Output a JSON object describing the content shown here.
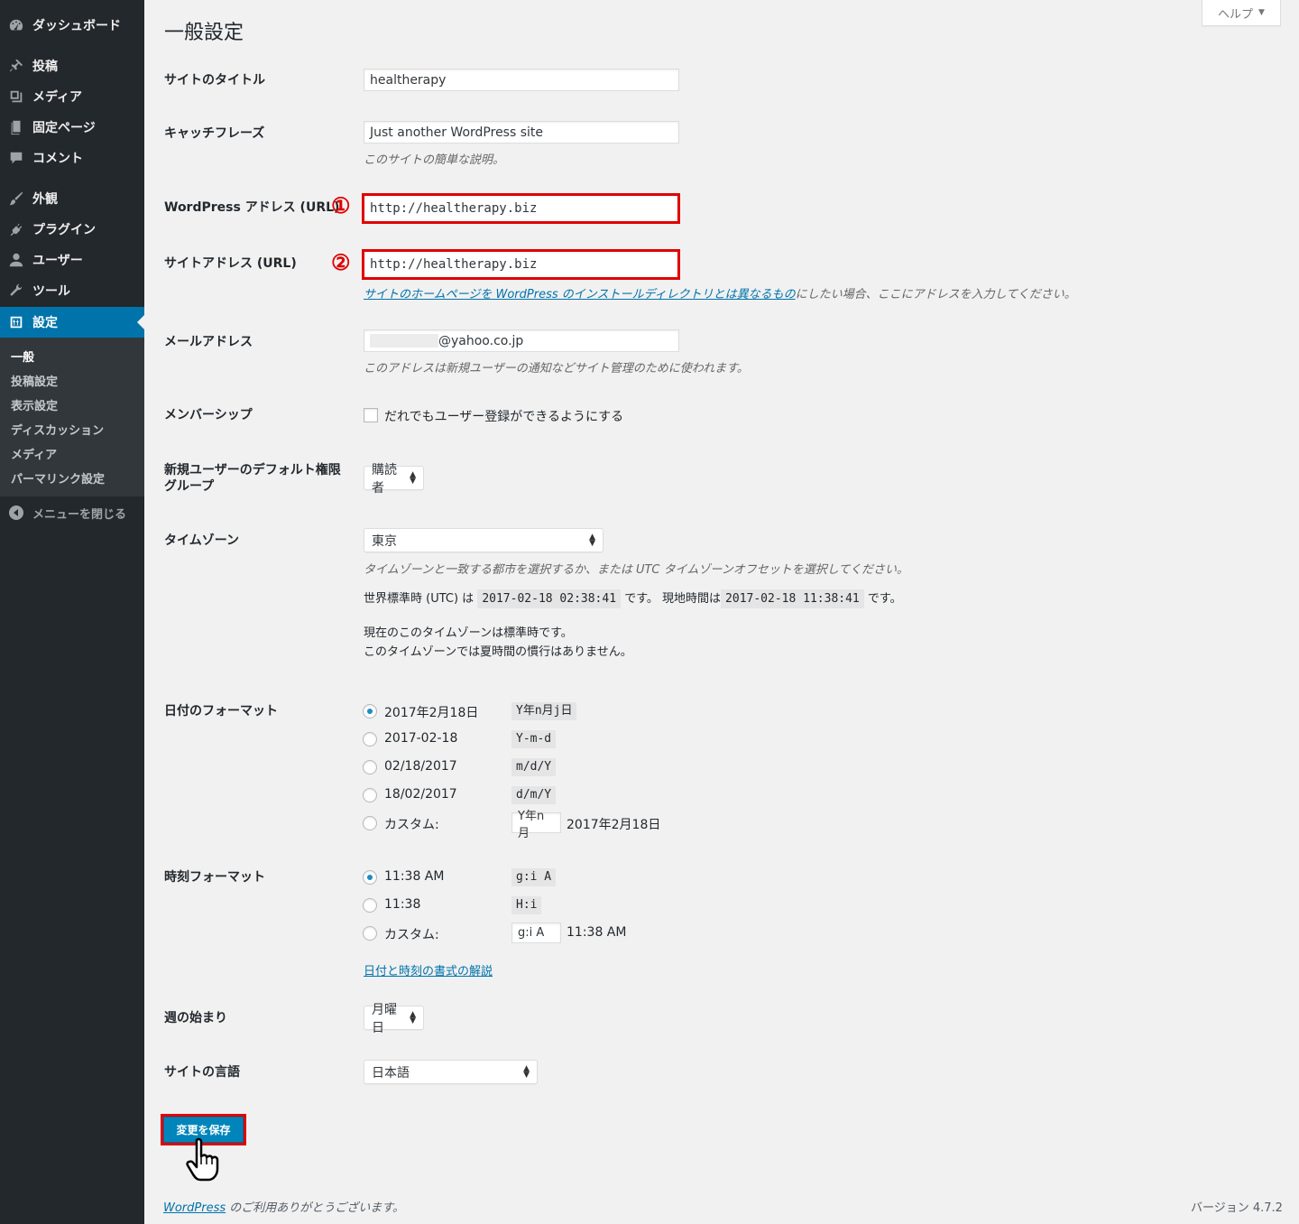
{
  "help": {
    "label": "ヘルプ",
    "arrow": "▼"
  },
  "sidebar": {
    "items": [
      {
        "label": "ダッシュボード",
        "icon": "dashboard-icon"
      },
      {
        "label": "投稿",
        "icon": "pin-icon"
      },
      {
        "label": "メディア",
        "icon": "media-icon"
      },
      {
        "label": "固定ページ",
        "icon": "page-icon"
      },
      {
        "label": "コメント",
        "icon": "comment-icon"
      },
      {
        "label": "外観",
        "icon": "brush-icon"
      },
      {
        "label": "プラグイン",
        "icon": "plugin-icon"
      },
      {
        "label": "ユーザー",
        "icon": "user-icon"
      },
      {
        "label": "ツール",
        "icon": "wrench-icon"
      },
      {
        "label": "設定",
        "icon": "settings-icon"
      }
    ],
    "submenu": [
      "一般",
      "投稿設定",
      "表示設定",
      "ディスカッション",
      "メディア",
      "パーマリンク設定"
    ],
    "collapse": "メニューを閉じる"
  },
  "page": {
    "title": "一般設定"
  },
  "fields": {
    "site_title": {
      "label": "サイトのタイトル",
      "value": "healtherapy"
    },
    "tagline": {
      "label": "キャッチフレーズ",
      "value": "Just another WordPress site",
      "desc": "このサイトの簡単な説明。"
    },
    "wp_url": {
      "label": "WordPress アドレス (URL)",
      "value": "http://healtherapy.biz",
      "marker": "①"
    },
    "site_url": {
      "label": "サイトアドレス (URL)",
      "value": "http://healtherapy.biz",
      "marker": "②",
      "desc_link": "サイトのホームページを WordPress のインストールディレクトリとは異なるもの",
      "desc_rest": "にしたい場合、ここにアドレスを入力してください。"
    },
    "email": {
      "label": "メールアドレス",
      "value": "@yahoo.co.jp",
      "desc": "このアドレスは新規ユーザーの通知などサイト管理のために使われます。"
    },
    "membership": {
      "label": "メンバーシップ",
      "checkbox": "だれでもユーザー登録ができるようにする"
    },
    "default_role": {
      "label_1": "新規ユーザーのデフォルト権限",
      "label_2": "グループ",
      "value": "購読者"
    },
    "timezone": {
      "label": "タイムゾーン",
      "value": "東京",
      "desc": "タイムゾーンと一致する都市を選択するか、または UTC タイムゾーンオフセットを選択してください。",
      "utc_prefix": "世界標準時 (UTC) は",
      "utc_time": "2017-02-18 02:38:41",
      "utc_suffix": "です。",
      "local_prefix": "現地時間は",
      "local_time": "2017-02-18 11:38:41",
      "local_suffix": "です。",
      "note1": "現在のこのタイムゾーンは標準時です。",
      "note2": "このタイムゾーンでは夏時間の慣行はありません。"
    },
    "date_format": {
      "label": "日付のフォーマット",
      "options": [
        {
          "text": "2017年2月18日",
          "code": "Y年n月j日",
          "checked": true
        },
        {
          "text": "2017-02-18",
          "code": "Y-m-d",
          "checked": false
        },
        {
          "text": "02/18/2017",
          "code": "m/d/Y",
          "checked": false
        },
        {
          "text": "18/02/2017",
          "code": "d/m/Y",
          "checked": false
        }
      ],
      "custom_label": "カスタム:",
      "custom_value": "Y年n月",
      "custom_preview": "2017年2月18日"
    },
    "time_format": {
      "label": "時刻フォーマット",
      "options": [
        {
          "text": "11:38 AM",
          "code": "g:i A",
          "checked": true
        },
        {
          "text": "11:38",
          "code": "H:i",
          "checked": false
        }
      ],
      "custom_label": "カスタム:",
      "custom_value": "g:i A",
      "custom_preview": "11:38 AM",
      "doc_link": "日付と時刻の書式の解説"
    },
    "week_start": {
      "label": "週の始まり",
      "value": "月曜日"
    },
    "language": {
      "label": "サイトの言語",
      "value": "日本語"
    }
  },
  "save_button": "変更を保存",
  "footer": {
    "link": "WordPress",
    "text": " のご利用ありがとうございます。",
    "version": "バージョン 4.7.2"
  }
}
